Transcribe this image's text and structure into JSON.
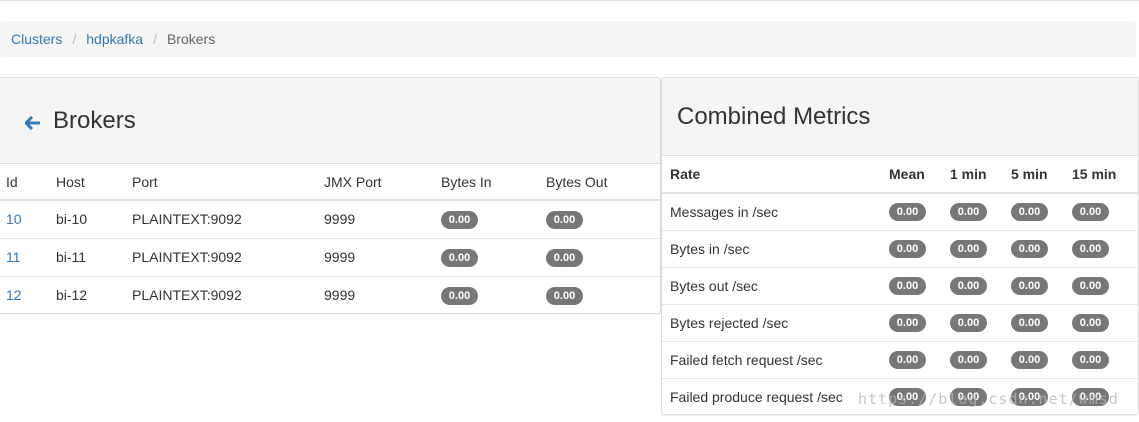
{
  "breadcrumb": {
    "items": [
      "Clusters",
      "hdpkafka"
    ],
    "active": "Brokers",
    "separator": "/"
  },
  "brokers_panel": {
    "title": "Brokers",
    "back_icon": "arrow-left-icon",
    "columns": [
      "Id",
      "Host",
      "Port",
      "JMX Port",
      "Bytes In",
      "Bytes Out"
    ],
    "rows": [
      {
        "id": "10",
        "host": "bi-10",
        "port": "PLAINTEXT:9092",
        "jmx": "9999",
        "bytes_in": "0.00",
        "bytes_out": "0.00"
      },
      {
        "id": "11",
        "host": "bi-11",
        "port": "PLAINTEXT:9092",
        "jmx": "9999",
        "bytes_in": "0.00",
        "bytes_out": "0.00"
      },
      {
        "id": "12",
        "host": "bi-12",
        "port": "PLAINTEXT:9092",
        "jmx": "9999",
        "bytes_in": "0.00",
        "bytes_out": "0.00"
      }
    ]
  },
  "metrics_panel": {
    "title": "Combined Metrics",
    "columns": [
      "Rate",
      "Mean",
      "1 min",
      "5 min",
      "15 min"
    ],
    "rows": [
      {
        "rate": "Messages in /sec",
        "mean": "0.00",
        "m1": "0.00",
        "m5": "0.00",
        "m15": "0.00"
      },
      {
        "rate": "Bytes in /sec",
        "mean": "0.00",
        "m1": "0.00",
        "m5": "0.00",
        "m15": "0.00"
      },
      {
        "rate": "Bytes out /sec",
        "mean": "0.00",
        "m1": "0.00",
        "m5": "0.00",
        "m15": "0.00"
      },
      {
        "rate": "Bytes rejected /sec",
        "mean": "0.00",
        "m1": "0.00",
        "m5": "0.00",
        "m15": "0.00"
      },
      {
        "rate": "Failed fetch request /sec",
        "mean": "0.00",
        "m1": "0.00",
        "m5": "0.00",
        "m15": "0.00"
      },
      {
        "rate": "Failed produce request /sec",
        "mean": "0.00",
        "m1": "0.00",
        "m5": "0.00",
        "m15": "0.00"
      }
    ]
  },
  "watermark": "https://blog.csdn.net/wmsd",
  "colors": {
    "link": "#337ab7",
    "badge": "#777777",
    "panel_heading": "#f5f5f5"
  }
}
